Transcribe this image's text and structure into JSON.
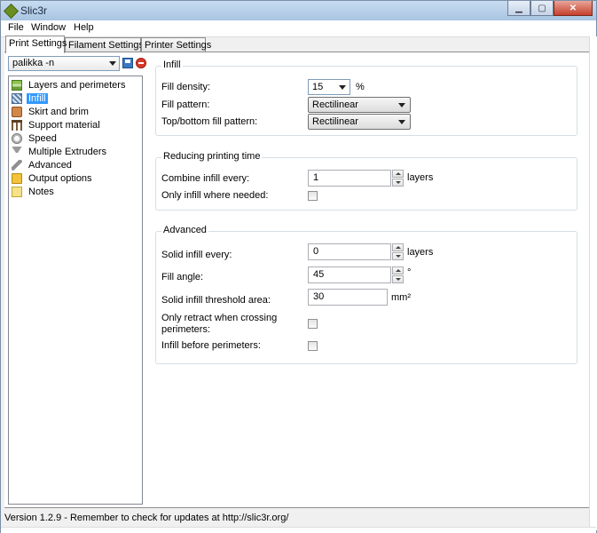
{
  "window": {
    "title": "Slic3r"
  },
  "menu": {
    "file": "File",
    "window": "Window",
    "help": "Help"
  },
  "tabs": [
    "Print Settings",
    "Filament Settings",
    "Printer Settings"
  ],
  "preset": {
    "value": "palikka -n"
  },
  "sidebar": {
    "items": [
      {
        "label": "Layers and perimeters",
        "icon": "layers-icon"
      },
      {
        "label": "Infill",
        "icon": "infill-icon",
        "selected": true
      },
      {
        "label": "Skirt and brim",
        "icon": "skirt-icon"
      },
      {
        "label": "Support material",
        "icon": "support-icon"
      },
      {
        "label": "Speed",
        "icon": "speed-icon"
      },
      {
        "label": "Multiple Extruders",
        "icon": "extruder-icon"
      },
      {
        "label": "Advanced",
        "icon": "wrench-icon"
      },
      {
        "label": "Output options",
        "icon": "output-icon"
      },
      {
        "label": "Notes",
        "icon": "notes-icon"
      }
    ]
  },
  "infill": {
    "title": "Infill",
    "fill_density_label": "Fill density:",
    "fill_density_value": "15",
    "fill_density_unit": "%",
    "fill_pattern_label": "Fill pattern:",
    "fill_pattern_value": "Rectilinear",
    "top_bottom_label": "Top/bottom fill pattern:",
    "top_bottom_value": "Rectilinear"
  },
  "reducing": {
    "title": "Reducing printing time",
    "combine_label": "Combine infill every:",
    "combine_value": "1",
    "combine_unit": "layers",
    "only_where_needed_label": "Only infill where needed:"
  },
  "advanced": {
    "title": "Advanced",
    "solid_every_label": "Solid infill every:",
    "solid_every_value": "0",
    "solid_every_unit": "layers",
    "fill_angle_label": "Fill angle:",
    "fill_angle_value": "45",
    "fill_angle_unit": "°",
    "threshold_label": "Solid infill threshold area:",
    "threshold_value": "30",
    "threshold_unit": "mm²",
    "only_retract_label_1": "Only retract when crossing",
    "only_retract_label_2": "perimeters:",
    "infill_before_label": "Infill before perimeters:"
  },
  "status": {
    "text": "Version 1.2.9 - Remember to check for updates at http://slic3r.org/"
  }
}
